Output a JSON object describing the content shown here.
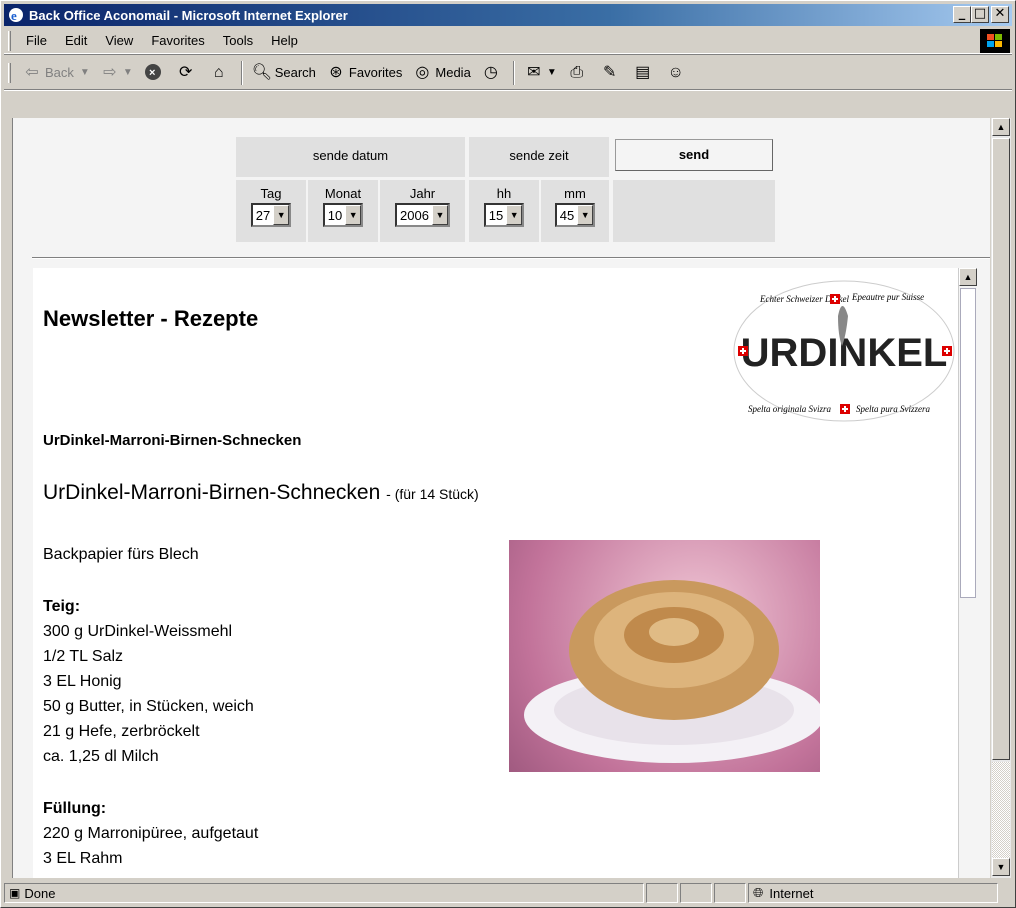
{
  "window": {
    "title": "Back Office Aconomail - Microsoft Internet Explorer"
  },
  "menu": [
    "File",
    "Edit",
    "View",
    "Favorites",
    "Tools",
    "Help"
  ],
  "toolbar": {
    "back": "Back",
    "search": "Search",
    "favorites": "Favorites",
    "media": "Media"
  },
  "form": {
    "send_date_label": "sende datum",
    "send_time_label": "sende zeit",
    "send_button": "send",
    "day_label": "Tag",
    "month_label": "Monat",
    "year_label": "Jahr",
    "hour_label": "hh",
    "minute_label": "mm",
    "day_value": "27",
    "month_value": "10",
    "year_value": "2006",
    "hour_value": "15",
    "minute_value": "45"
  },
  "newsletter": {
    "title": "Newsletter - Rezepte",
    "logo_text": {
      "top": "Echter Schweizer Dinkel",
      "top_right": "Epeautre pur Suisse",
      "center": "URDINKEL",
      "bottom_left": "Spelta originala Svizra",
      "bottom_right": "Spelta pura Svizzera"
    },
    "recipe_small_title": "UrDinkel-Marroni-Birnen-Schnecken",
    "recipe_title": "UrDinkel-Marroni-Birnen-Schnecken",
    "recipe_subtitle": "- (für 14 Stück)",
    "intro": "Backpapier fürs Blech",
    "teig_heading": "Teig:",
    "teig_items": [
      "300 g UrDinkel-Weissmehl",
      "1/2 TL Salz",
      "3 EL Honig",
      "50 g Butter, in Stücken, weich",
      "21 g Hefe, zerbröckelt",
      "ca. 1,25 dl Milch"
    ],
    "fuellung_heading": "Füllung:",
    "fuellung_items": [
      "220 g Marronipüree, aufgetaut",
      "3 EL Rahm"
    ]
  },
  "status": {
    "text": "Done",
    "zone": "Internet"
  }
}
